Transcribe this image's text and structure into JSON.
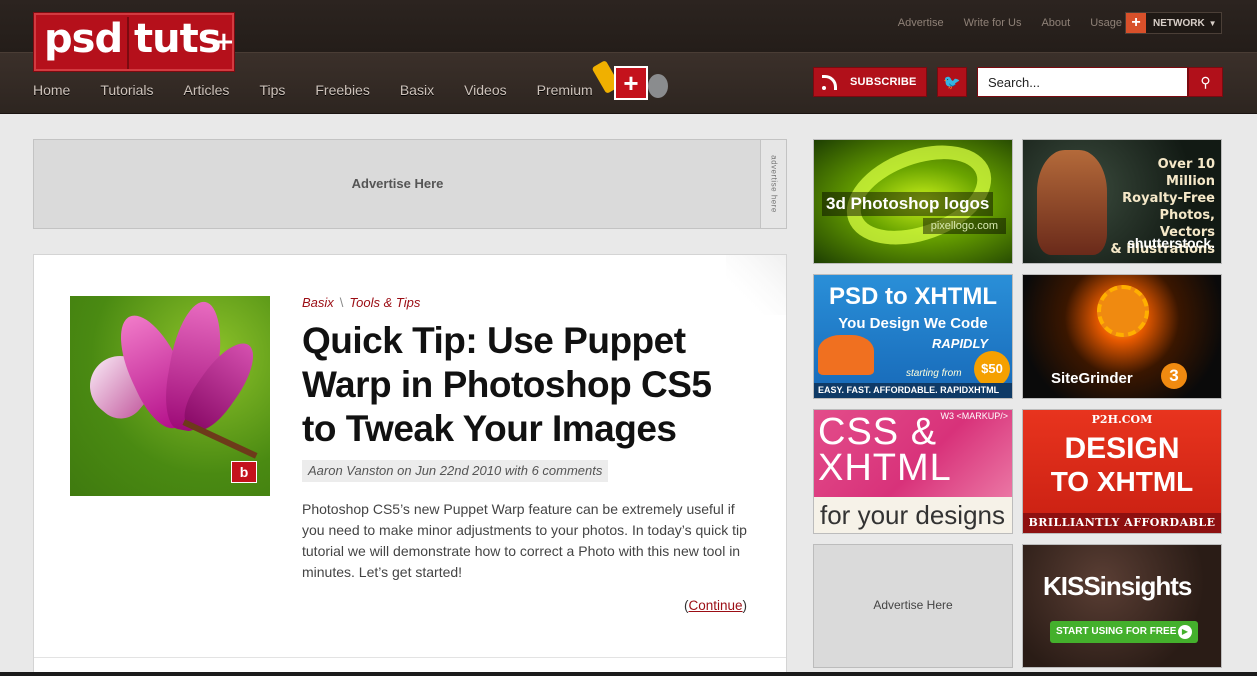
{
  "site": {
    "logo_psd": "psd",
    "logo_tuts": "tuts",
    "logo_plus": "+"
  },
  "topnav": {
    "items": [
      "Advertise",
      "Write for Us",
      "About",
      "Usage"
    ],
    "network_label": "NETWORK",
    "network_icon_glyph": "+"
  },
  "mainnav": {
    "items": [
      "Home",
      "Tutorials",
      "Articles",
      "Tips",
      "Freebies",
      "Basix",
      "Videos",
      "Premium"
    ]
  },
  "actions": {
    "subscribe_label": "SUBSCRIBE",
    "search_placeholder": "Search..."
  },
  "banner_ad": {
    "text": "Advertise Here",
    "tab": "advertise here"
  },
  "post": {
    "categories": [
      "Basix",
      "Tools & Tips"
    ],
    "category_separator": "\\",
    "title": "Quick Tip: Use Puppet Warp in Photoshop CS5 to Tweak Your Images",
    "meta": "Aaron Vanston on Jun 22nd 2010 with 6 comments",
    "excerpt": "Photoshop CS5’s new Puppet Warp feature can be extremely useful if you need to make minor adjustments to your photos. In today’s quick tip tutorial we will demonstrate how to correct a Photo with this new tool in minutes. Let’s get started!",
    "continue_label": "Continue",
    "badge": "b"
  },
  "sidebar_ads": {
    "ad1": {
      "title": "3d Photoshop logos",
      "sub": "pixellogo.com"
    },
    "ad2": {
      "lines": [
        "Over 10 Million",
        "Royalty-Free",
        "Photos, Vectors",
        "& Illustrations"
      ],
      "brand": "shutterstock."
    },
    "ad3": {
      "t1": "PSD to XHTML",
      "t2": "You Design We Code",
      "t3": "RAPIDLY",
      "start": "starting from",
      "price": "$50",
      "strip": "EASY. FAST. AFFORDABLE. RAPIDXHTML"
    },
    "ad4": {
      "name": "SiteGrinder",
      "num": "3"
    },
    "ad5": {
      "tag": "W3 <MARKUP/>",
      "t1": "CSS &",
      "t2": "XHTML",
      "t3": "for your designs"
    },
    "ad6": {
      "top": "P2H.COM",
      "big1": "DESIGN",
      "big2": "TO XHTML",
      "strip": "BRILLIANTLY AFFORDABLE"
    },
    "ad7": {
      "label": "Advertise Here"
    },
    "ad8": {
      "brand": "KISSinsights",
      "cta": "START USING FOR FREE"
    }
  },
  "colors": {
    "brand_red": "#b1101a",
    "header_dark": "#2c2420",
    "link_red": "#9b0d14"
  }
}
